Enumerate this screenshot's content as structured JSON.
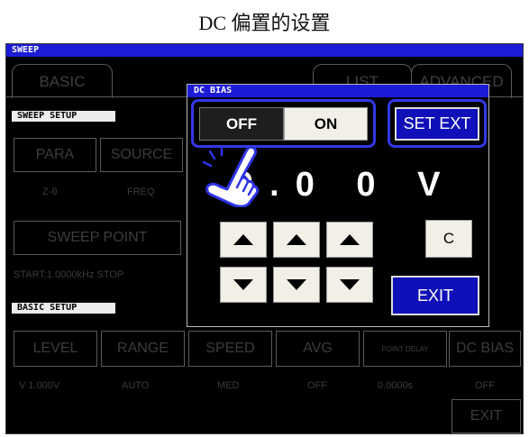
{
  "caption": "DC 偏置的设置",
  "screen": {
    "title": "SWEEP",
    "tabs": {
      "basic": "BASIC",
      "list": "LIST",
      "advanced": "ADVANCED"
    },
    "sweep_setup": {
      "header": "SWEEP SETUP",
      "para_label": "PARA",
      "para_value": "Z-θ",
      "source_label": "SOURCE",
      "source_value": "FREQ",
      "sweep_point_label": "SWEEP POINT",
      "start_stop_text": "START:1.0000kHz STOP"
    },
    "basic_setup": {
      "header": "BASIC SETUP",
      "buttons": [
        {
          "label": "LEVEL",
          "value": "V 1.000V"
        },
        {
          "label": "RANGE",
          "value": "AUTO"
        },
        {
          "label": "SPEED",
          "value": "MED"
        },
        {
          "label": "AVG",
          "value": "OFF"
        },
        {
          "label": "POINT DELAY",
          "value": "0.0000s"
        },
        {
          "label": "DC BIAS",
          "value": "OFF"
        }
      ]
    },
    "exit_label": "EXIT"
  },
  "dialog": {
    "title": "DC BIAS",
    "off_label": "OFF",
    "on_label": "ON",
    "set_ext_label": "SET EXT",
    "value_display": "0.0 0 V",
    "clear_label": "C",
    "exit_label": "EXIT"
  },
  "colors": {
    "highlight": "#3437e6",
    "titlebar": "#1c1cd6",
    "exit_button": "#1010b8"
  }
}
